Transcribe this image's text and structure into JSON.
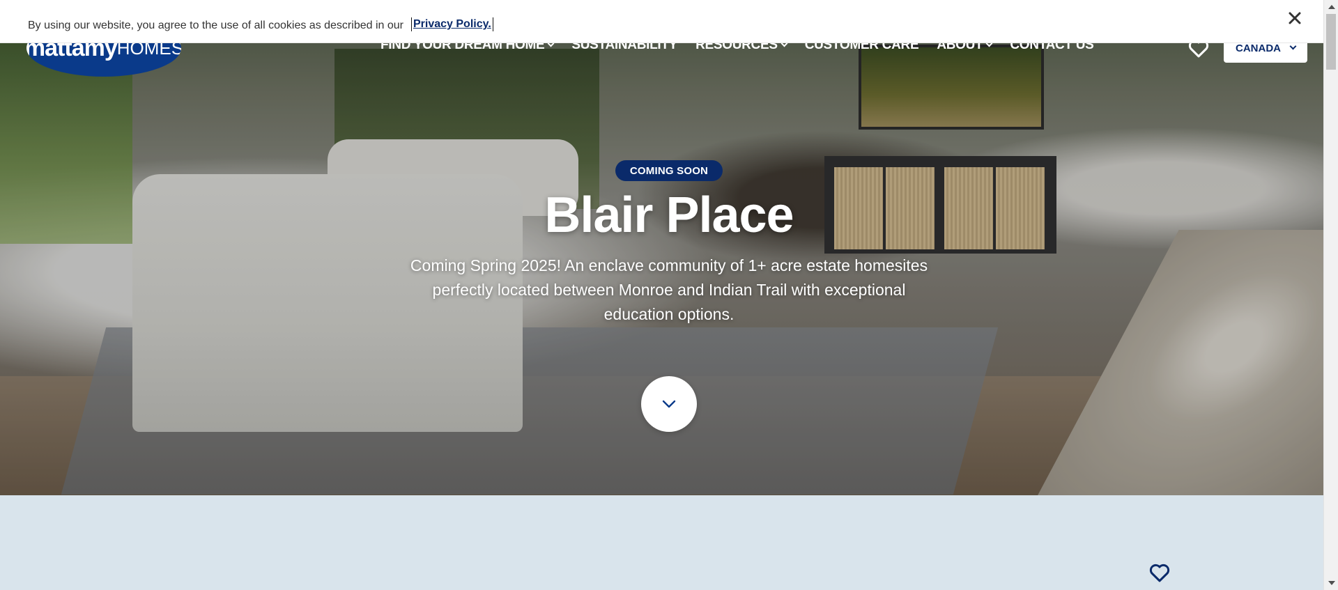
{
  "cookie_banner": {
    "text": "By using our website, you agree to the use of all cookies as described in our",
    "link_label": "Privacy Policy.",
    "close_icon": "close-icon"
  },
  "header": {
    "logo_main": "mattamy",
    "logo_sub": "HOMES",
    "nav": [
      {
        "label": "FIND YOUR DREAM HOME",
        "dropdown": true
      },
      {
        "label": "SUSTAINABILITY",
        "dropdown": false
      },
      {
        "label": "RESOURCES",
        "dropdown": true
      },
      {
        "label": "CUSTOMER CARE",
        "dropdown": false
      },
      {
        "label": "ABOUT",
        "dropdown": true
      },
      {
        "label": "CONTACT US",
        "dropdown": false
      }
    ],
    "favorites_icon": "heart-icon",
    "country_label": "CANADA"
  },
  "hero": {
    "badge": "COMING SOON",
    "title": "Blair Place",
    "description": "Coming Spring 2025! An enclave community of 1+ acre estate homesites perfectly located between Monroe and Indian Trail with exceptional education options.",
    "scroll_icon": "chevron-down-icon"
  },
  "lower_section": {
    "favorite_icon": "heart-icon"
  },
  "colors": {
    "brand_navy": "#0a2a6a",
    "logo_blue": "#0a3a8a",
    "lower_bg": "#d9e4ec"
  }
}
